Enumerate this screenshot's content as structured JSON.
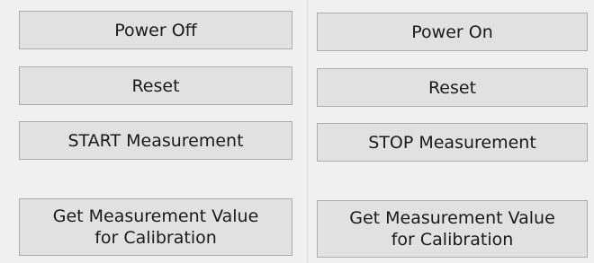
{
  "left_panel": {
    "power_label": "Power Off",
    "reset_label": "Reset",
    "measurement_label": "START Measurement",
    "calibration_label": "Get Measurement Value\nfor Calibration"
  },
  "right_panel": {
    "power_label": "Power On",
    "reset_label": "Reset",
    "measurement_label": "STOP Measurement",
    "calibration_label": "Get Measurement Value\nfor Calibration"
  },
  "colors": {
    "background": "#f0f0f0",
    "button_face": "#e1e1e1",
    "button_border": "#adadad",
    "text": "#1a1a1a"
  }
}
